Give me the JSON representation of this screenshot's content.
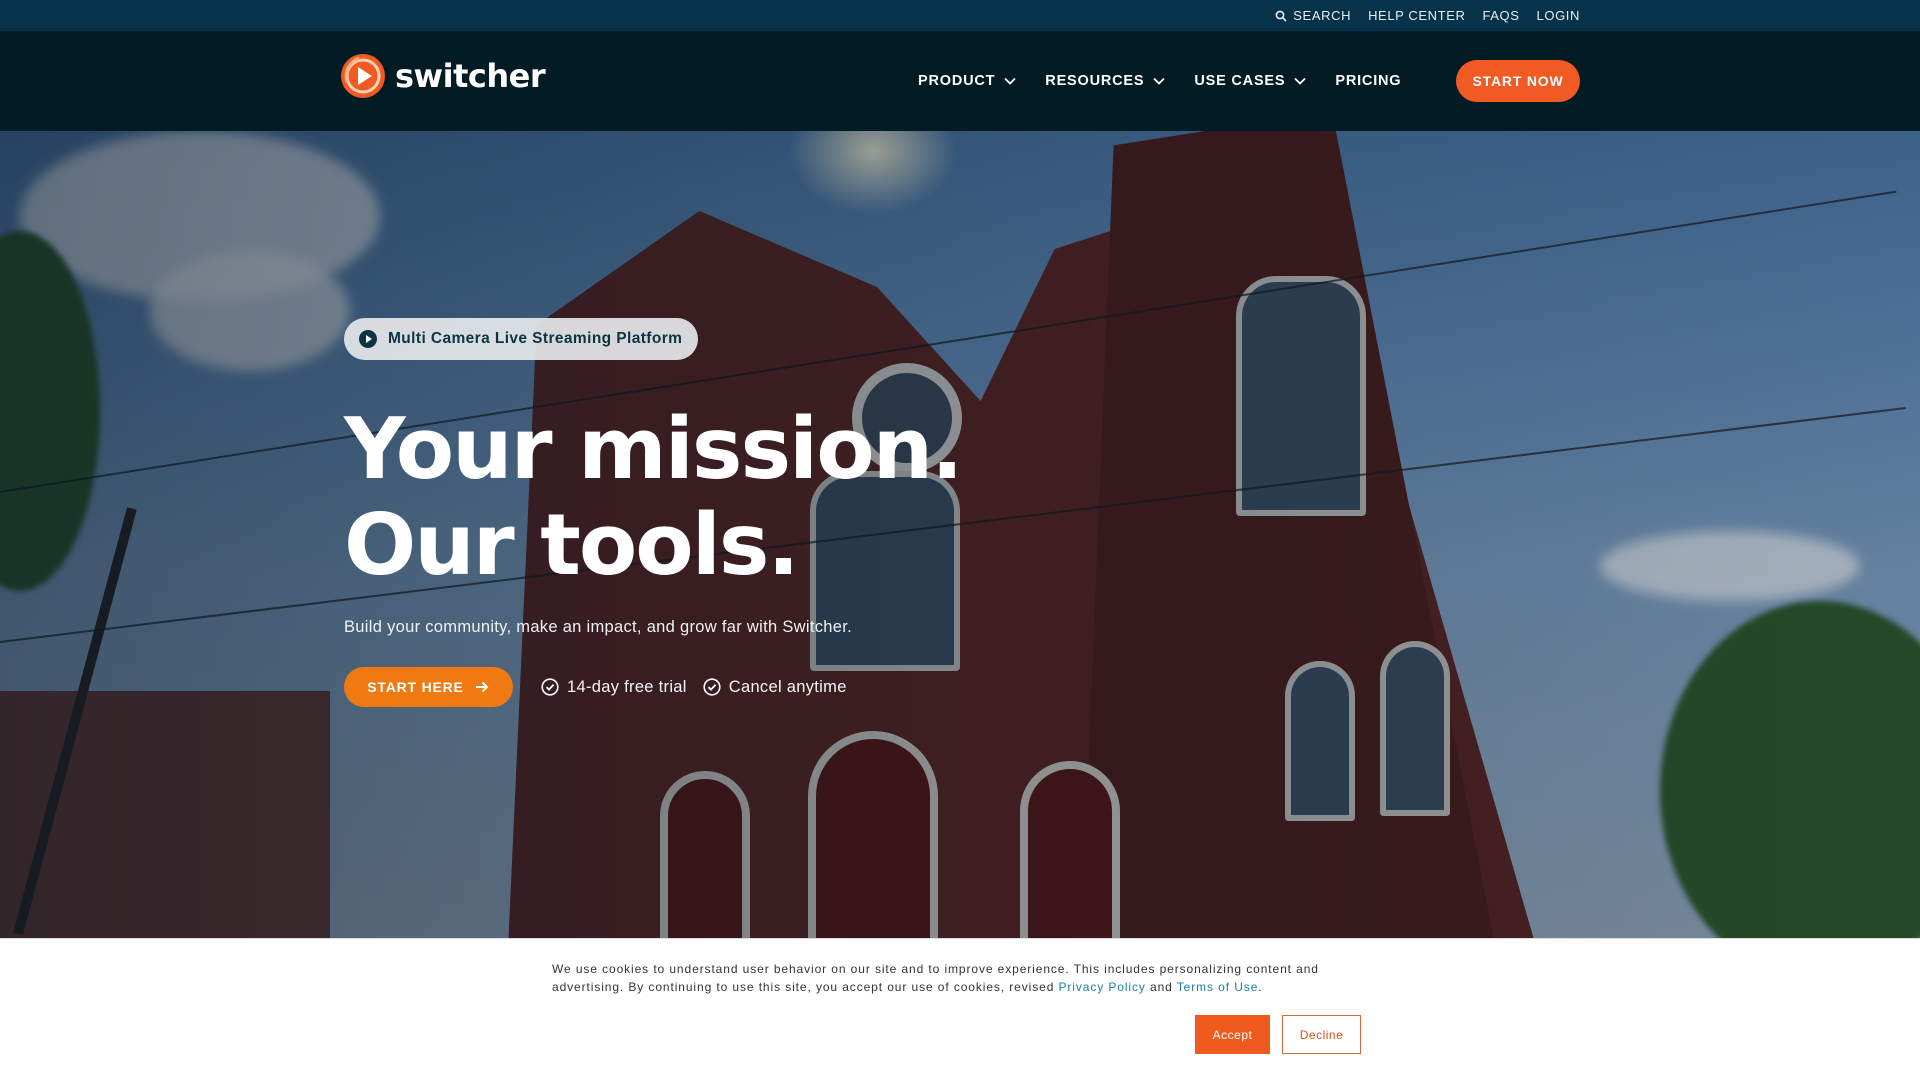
{
  "utility_nav": {
    "search_label": "SEARCH",
    "help_center": "HELP CENTER",
    "faqs": "FAQS",
    "login": "LOGIN"
  },
  "main_nav": {
    "logo_text": "switcher",
    "items": [
      {
        "label": "PRODUCT",
        "has_dropdown": true
      },
      {
        "label": "RESOURCES",
        "has_dropdown": true
      },
      {
        "label": "USE CASES",
        "has_dropdown": true
      },
      {
        "label": "PRICING",
        "has_dropdown": false
      }
    ],
    "cta_label": "START NOW"
  },
  "hero": {
    "tag": "Multi Camera Live Streaming Platform",
    "headline_line1": "Your mission.",
    "headline_line2": "Our tools.",
    "subtitle": "Build your community, make an impact, and grow far with Switcher.",
    "cta_label": "START HERE",
    "check_1": "14-day free trial",
    "check_2": "Cancel anytime"
  },
  "cookie_banner": {
    "text_before": "We use cookies to understand user behavior on our site and to improve experience. This includes personalizing content and advertising. By continuing to use this site, you accept our use of cookies, revised ",
    "privacy_link": "Privacy Policy",
    "text_and": " and ",
    "terms_link": "Terms of Use",
    "text_end": ".",
    "accept_label": "Accept",
    "decline_label": "Decline"
  },
  "colors": {
    "utility_bar_bg": "#063349",
    "nav_bg": "#031b24",
    "brand_orange": "#f15a22",
    "cta_orange": "#f07a12",
    "link_blue": "#1a7fa6"
  },
  "icons": [
    "search-icon",
    "chevron-down-icon",
    "play-circle-icon",
    "arrow-right-icon",
    "check-circle-icon",
    "switcher-logo"
  ]
}
